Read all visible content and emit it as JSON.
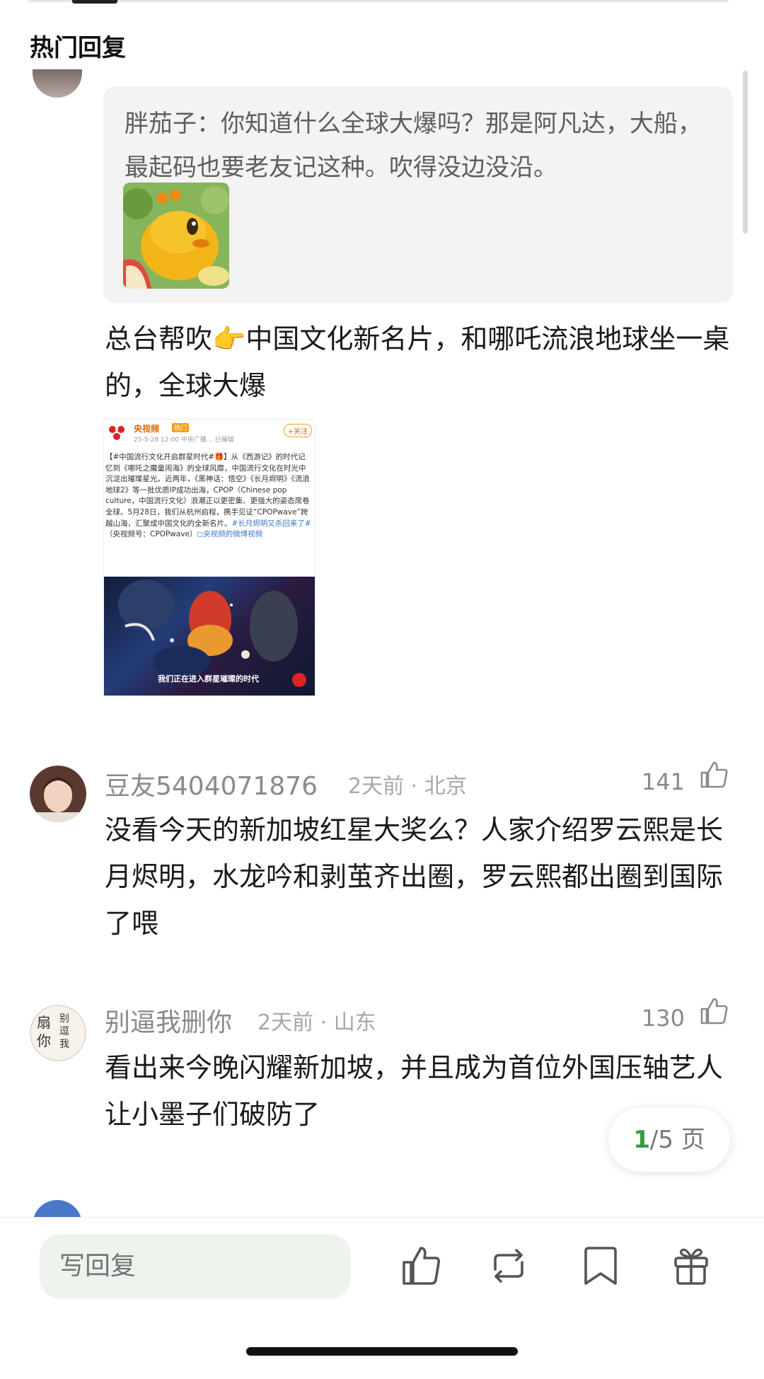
{
  "section": {
    "title": "热门回复"
  },
  "reply": {
    "quote": "胖茄子：你知道什么全球大爆吗？那是阿凡达，大船，最起码也要老友记这种。吹得没边没沿。",
    "text": "总台帮吹👉中国文化新名片，和哪吒流浪地球坐一桌的，全球大爆"
  },
  "embed": {
    "account": "央视频",
    "badge": "热门",
    "meta": "25-5-28 12:00  中央广播…  已编辑",
    "follow": "+关注",
    "body_prefix": "【#中国流行文化开启群星时代#🎁】从《西游记》的时代记忆到《哪吒之魔童闹海》的全球风靡，中国流行文化在时光中沉淀出璀璨星光。近两年，《黑神话：悟空》《长月烬明》《流浪地球2》等一批优质IP成功出海，CPOP（Chinese pop culture，中国流行文化）浪潮正以更密集、更强大的姿态席卷全球。5月28日，我们从杭州启程，携手见证“CPOPwave”跨越山海，汇聚成中国文化的全新名片。",
    "body_link1": "#长月烬明又杀回来了#",
    "body_mid": "（央视频号：CPOPwave）",
    "body_link2": "◻央视频的微博视频",
    "caption": "我们正在进入群星璀璨的时代"
  },
  "comments": [
    {
      "name": "豆友5404071876",
      "meta": "2天前 · 北京",
      "likes": "141",
      "text": "没看今天的新加坡红星大奖么？人家介绍罗云熙是长月烬明，水龙吟和剥茧齐出圈，罗云熙都出圈到国际了喂"
    },
    {
      "name": "别逼我删你",
      "meta": "2天前 · 山东",
      "likes": "130",
      "text": "看出来今晚闪耀新加坡，并且成为首位外国压轴艺人让小墨子们破防了",
      "avatar_text": "扇你 别逗我"
    }
  ],
  "pager": {
    "current": "1",
    "total": "/5 页"
  },
  "bottom_bar": {
    "reply_placeholder": "写回复",
    "icons": [
      "like-icon",
      "repost-icon",
      "bookmark-icon",
      "gift-icon"
    ]
  }
}
